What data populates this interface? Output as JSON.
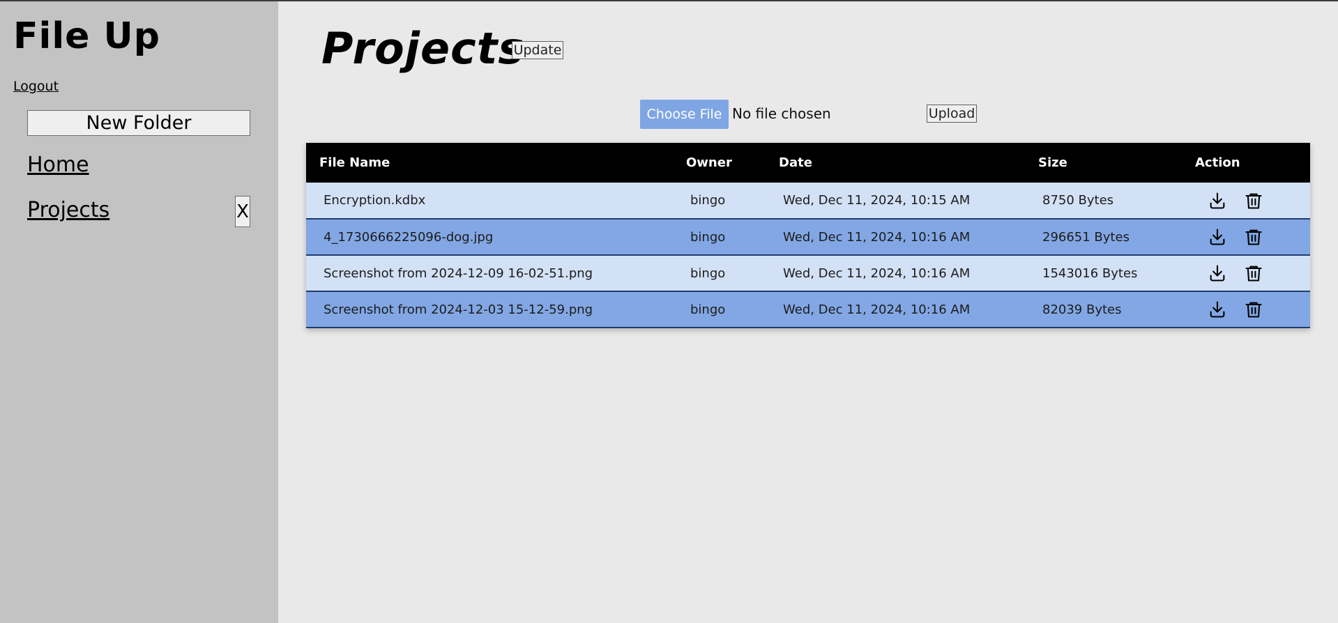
{
  "app": {
    "title": "File Up"
  },
  "sidebar": {
    "logout_label": "Logout",
    "new_folder_label": "New Folder",
    "items": [
      {
        "label": "Home"
      },
      {
        "label": "Projects",
        "remove_label": "X"
      }
    ]
  },
  "main": {
    "title": "Projects",
    "update_label": "Update",
    "upload": {
      "choose_file_label": "Choose File",
      "status_text": "No file chosen",
      "upload_label": "Upload"
    },
    "table": {
      "columns": [
        "File Name",
        "Owner",
        "Date",
        "Size",
        "Action"
      ],
      "rows": [
        {
          "name": "Encryption.kdbx",
          "owner": "bingo",
          "date": "Wed, Dec 11, 2024, 10:15 AM",
          "size": "8750 Bytes"
        },
        {
          "name": "4_1730666225096-dog.jpg",
          "owner": "bingo",
          "date": "Wed, Dec 11, 2024, 10:16 AM",
          "size": "296651 Bytes"
        },
        {
          "name": "Screenshot from 2024-12-09 16-02-51.png",
          "owner": "bingo",
          "date": "Wed, Dec 11, 2024, 10:16 AM",
          "size": "1543016 Bytes"
        },
        {
          "name": "Screenshot from 2024-12-03 15-12-59.png",
          "owner": "bingo",
          "date": "Wed, Dec 11, 2024, 10:16 AM",
          "size": "82039 Bytes"
        }
      ],
      "action_icons": [
        "download-icon",
        "trash-icon"
      ]
    }
  },
  "colors": {
    "sidebar_bg": "#c3c3c3",
    "main_bg": "#e9e9e9",
    "header_bg": "#000000",
    "row_light": "#d3e1f6",
    "row_dark": "#82a7e4",
    "accent": "#7fa6e4"
  }
}
